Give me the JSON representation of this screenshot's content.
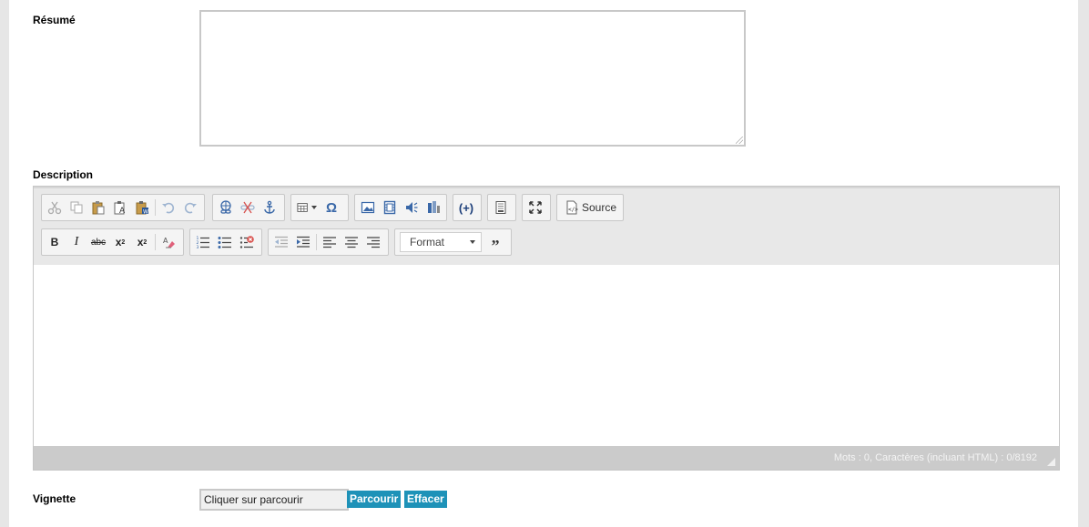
{
  "fields": {
    "resume_label": "Résumé",
    "description_label": "Description",
    "vignette_label": "Vignette"
  },
  "toolbar": {
    "source_label": "Source",
    "format_label": "Format"
  },
  "status": {
    "counter": "Mots : 0, Caractères (incluant HTML) : 0/8192"
  },
  "vignette": {
    "placeholder": "Cliquer sur parcourir",
    "browse_label": "Parcourir",
    "clear_label": "Effacer"
  },
  "colors": {
    "accent": "#1e92b8",
    "link_icon": "#3a68a8",
    "remove_red": "#d9534f"
  }
}
